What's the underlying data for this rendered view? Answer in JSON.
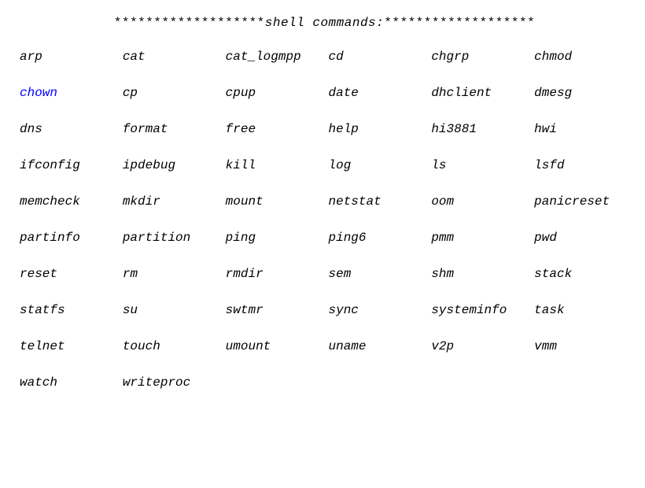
{
  "header": {
    "prefix": "*******************",
    "title": "shell commands:",
    "suffix": "*******************"
  },
  "highlight_command": "chown",
  "commands": [
    "arp",
    "cat",
    "cat_logmpp",
    "cd",
    "chgrp",
    "chmod",
    "chown",
    "cp",
    "cpup",
    "date",
    "dhclient",
    "dmesg",
    "dns",
    "format",
    "free",
    "help",
    "hi3881",
    "hwi",
    "ifconfig",
    "ipdebug",
    "kill",
    "log",
    "ls",
    "lsfd",
    "memcheck",
    "mkdir",
    "mount",
    "netstat",
    "oom",
    "panicreset",
    "partinfo",
    "partition",
    "ping",
    "ping6",
    "pmm",
    "pwd",
    "reset",
    "rm",
    "rmdir",
    "sem",
    "shm",
    "stack",
    "statfs",
    "su",
    "swtmr",
    "sync",
    "systeminfo",
    "task",
    "telnet",
    "touch",
    "umount",
    "uname",
    "v2p",
    "vmm",
    "watch",
    "writeproc"
  ]
}
